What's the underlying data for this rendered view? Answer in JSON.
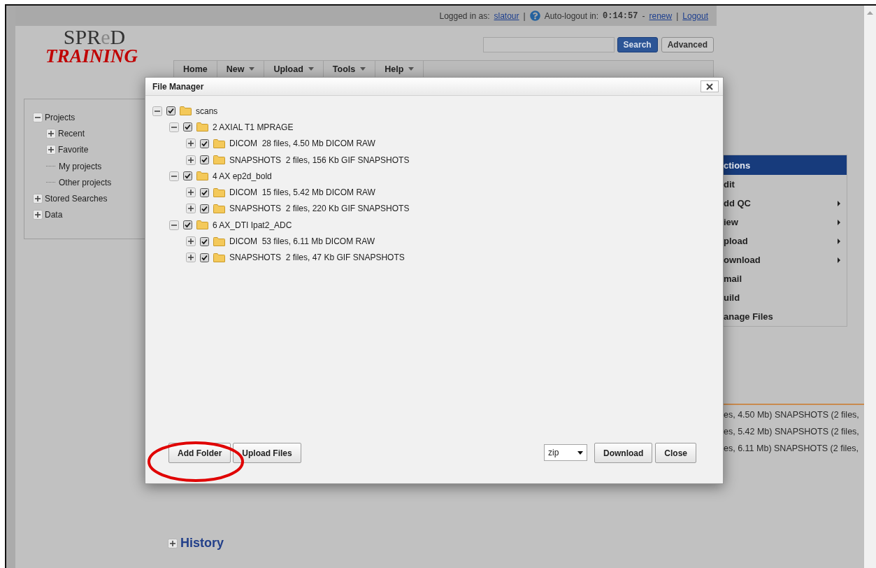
{
  "top_bar": {
    "logged_in_label": "Logged in as:",
    "user": "slatour",
    "separator_1": "|",
    "auto_logout_label": "Auto-logout in:",
    "timer": "0:14:57",
    "dash": "-",
    "renew": "renew",
    "separator_2": "|",
    "logout": "Logout"
  },
  "logo": {
    "name_parts": [
      {
        "text": "SPR",
        "faded": false
      },
      {
        "text": "e",
        "faded": true
      },
      {
        "text": "D",
        "faded": false
      }
    ],
    "subtitle": "TRAINING"
  },
  "search": {
    "button": "Search",
    "advanced": "Advanced"
  },
  "nav": [
    {
      "label": "Home",
      "has_menu": false
    },
    {
      "label": "New",
      "has_menu": true
    },
    {
      "label": "Upload",
      "has_menu": true
    },
    {
      "label": "Tools",
      "has_menu": true
    },
    {
      "label": "Help",
      "has_menu": true
    }
  ],
  "sidebar": {
    "items": [
      {
        "label": "Projects",
        "kind": "group",
        "expanded": true,
        "children": [
          {
            "label": "Recent",
            "kind": "group",
            "expanded": false
          },
          {
            "label": "Favorite",
            "kind": "group",
            "expanded": false
          },
          {
            "label": "My projects",
            "kind": "link"
          },
          {
            "label": "Other projects",
            "kind": "link"
          }
        ]
      },
      {
        "label": "Stored Searches",
        "kind": "group",
        "expanded": false
      },
      {
        "label": "Data",
        "kind": "group",
        "expanded": false
      }
    ]
  },
  "actions": {
    "title": "ctions",
    "items": [
      {
        "label": "dit",
        "has_submenu": false
      },
      {
        "label": "dd QC",
        "has_submenu": true
      },
      {
        "label": "iew",
        "has_submenu": true
      },
      {
        "label": "pload",
        "has_submenu": true
      },
      {
        "label": "ownload",
        "has_submenu": true
      },
      {
        "label": "mail",
        "has_submenu": false
      },
      {
        "label": "uild",
        "has_submenu": false
      },
      {
        "label": "anage Files",
        "has_submenu": false
      }
    ]
  },
  "summary_rows": [
    "es, 4.50 Mb) SNAPSHOTS (2 files,",
    "es, 5.42 Mb) SNAPSHOTS (2 files,",
    "es, 6.11 Mb) SNAPSHOTS (2 files,"
  ],
  "history": {
    "label": "History",
    "expanded": false
  },
  "dialog": {
    "title": "File Manager",
    "tree": [
      {
        "name": "scans",
        "expanded": true,
        "checked": true,
        "children": [
          {
            "name": "2 AXIAL T1 MPRAGE",
            "expanded": true,
            "checked": true,
            "children": [
              {
                "name": "DICOM",
                "detail": "28 files, 4.50 Mb DICOM RAW",
                "expanded": false,
                "checked": true
              },
              {
                "name": "SNAPSHOTS",
                "detail": "2 files, 156 Kb GIF SNAPSHOTS",
                "expanded": false,
                "checked": true
              }
            ]
          },
          {
            "name": "4 AX ep2d_bold",
            "expanded": true,
            "checked": true,
            "children": [
              {
                "name": "DICOM",
                "detail": "15 files, 5.42 Mb DICOM RAW",
                "expanded": false,
                "checked": true
              },
              {
                "name": "SNAPSHOTS",
                "detail": "2 files, 220 Kb GIF SNAPSHOTS",
                "expanded": false,
                "checked": true
              }
            ]
          },
          {
            "name": "6 AX_DTI Ipat2_ADC",
            "expanded": true,
            "checked": true,
            "children": [
              {
                "name": "DICOM",
                "detail": "53 files, 6.11 Mb DICOM RAW",
                "expanded": false,
                "checked": true
              },
              {
                "name": "SNAPSHOTS",
                "detail": "2 files, 47 Kb GIF SNAPSHOTS",
                "expanded": false,
                "checked": true
              }
            ]
          }
        ]
      }
    ],
    "add_folder": "Add Folder",
    "upload_files": "Upload Files",
    "format": "zip",
    "download": "Download",
    "close": "Close"
  }
}
